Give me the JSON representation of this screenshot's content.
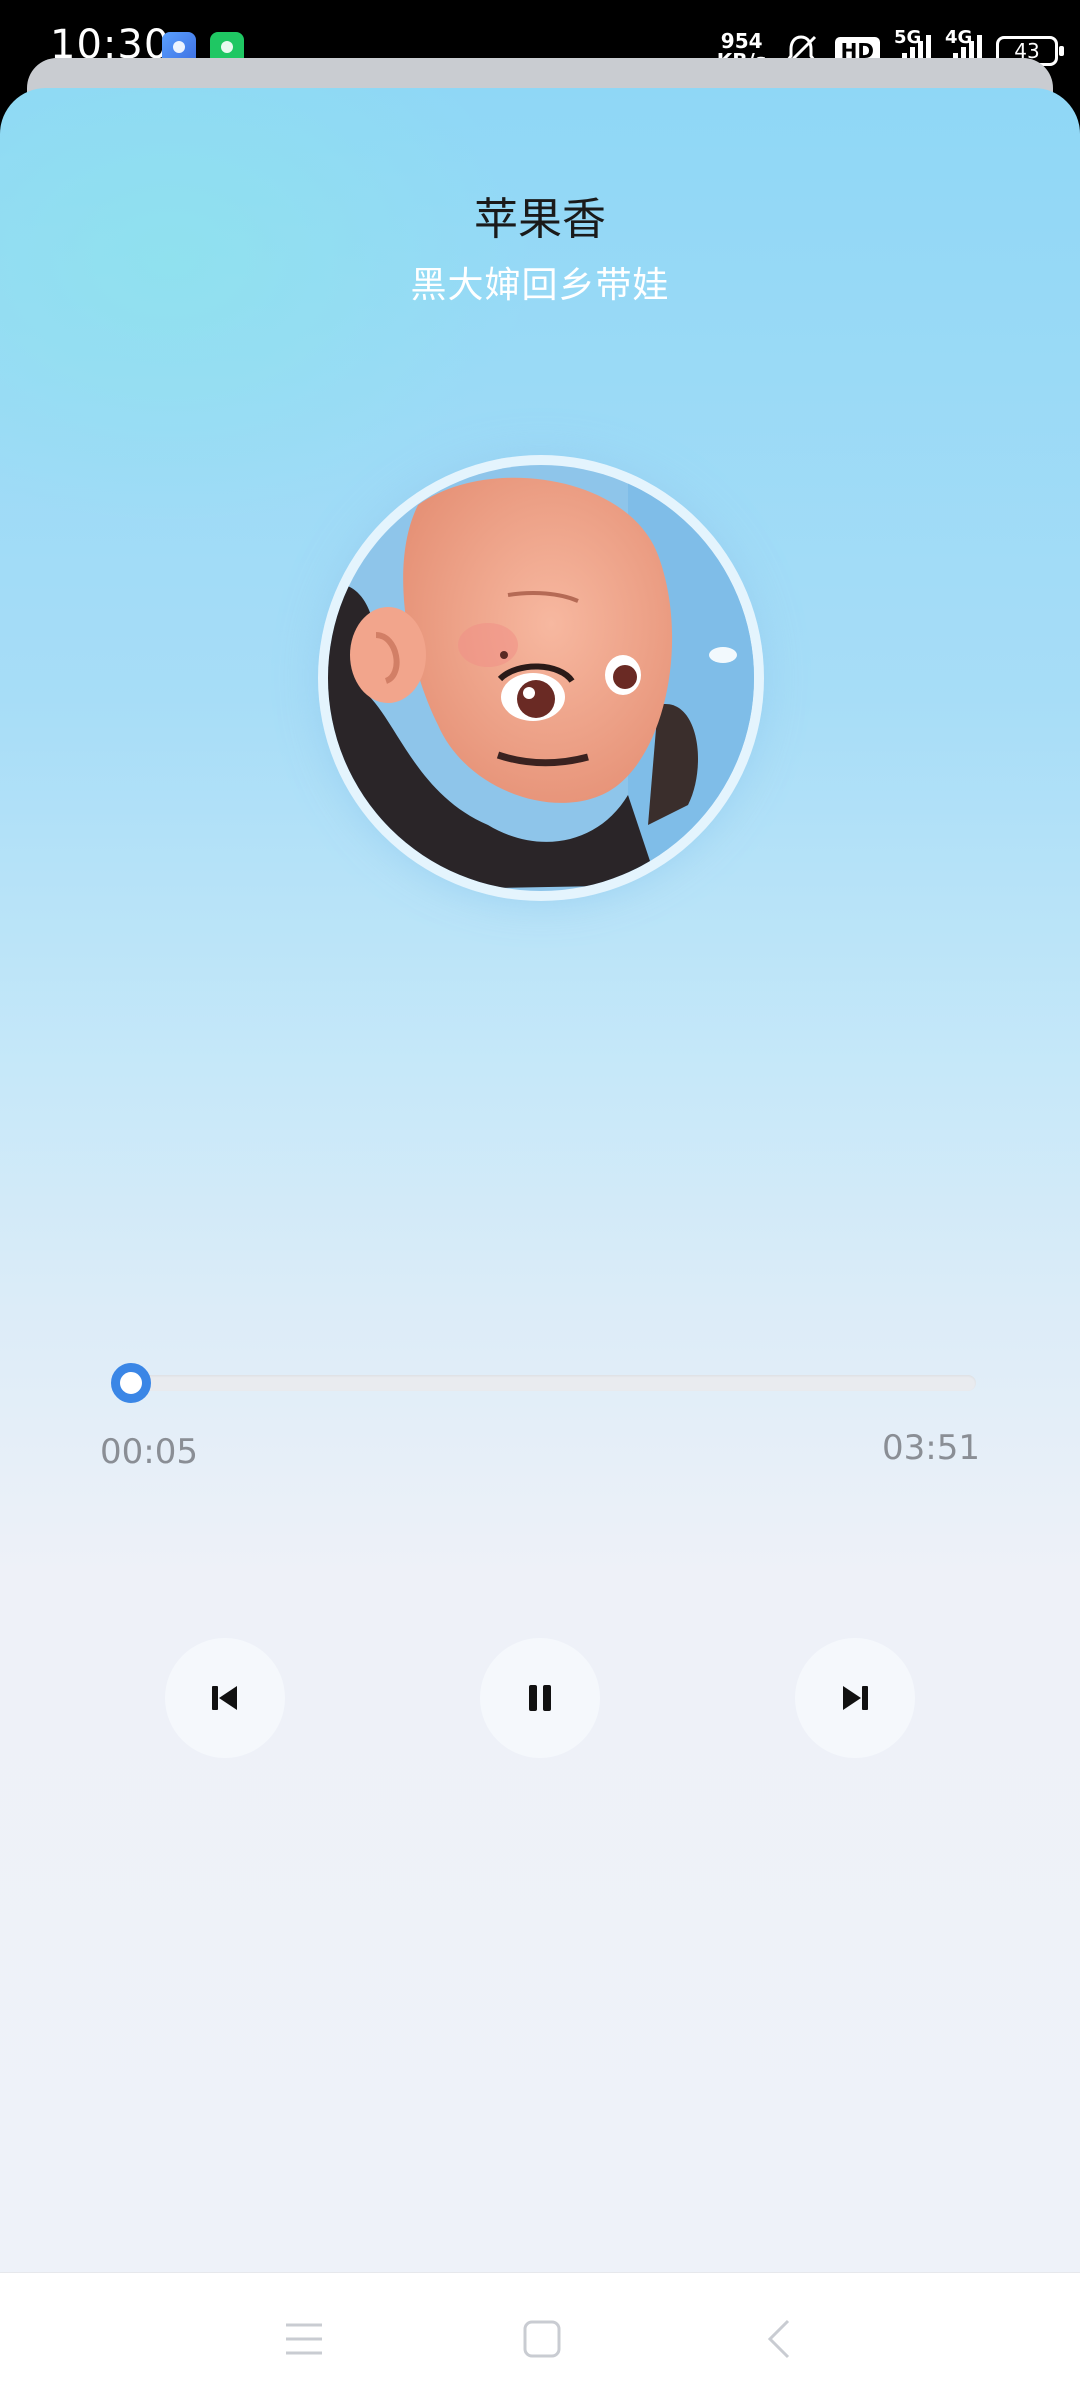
{
  "status_bar": {
    "time": "10:30",
    "net_speed_value": "954",
    "net_speed_unit": "KB/s",
    "hd_label": "HD",
    "network_1": "5G",
    "network_2": "4G",
    "battery": "43",
    "app_icons": [
      "app-icon-blue",
      "app-icon-green"
    ]
  },
  "player": {
    "song_title": "苹果香",
    "artist": "黑大婶回乡带娃",
    "current_time": "00:05",
    "total_time": "03:51",
    "progress_fraction": 0.022,
    "controls": {
      "prev": "skip-previous-icon",
      "play": "pause-icon",
      "next": "skip-next-icon"
    }
  },
  "navigation": {
    "menu": "menu-icon",
    "home": "home-icon",
    "back": "back-icon"
  },
  "colors": {
    "accent": "#3a86e6",
    "time_text": "#8a8e95",
    "control_bg": "#f5f8fc"
  }
}
